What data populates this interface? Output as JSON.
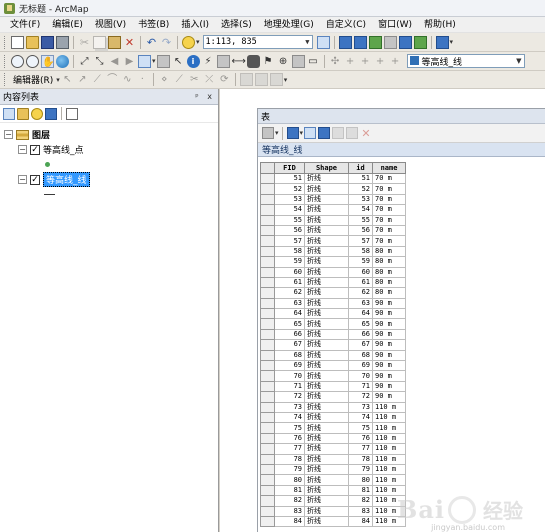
{
  "window": {
    "title": "无标题 - ArcMap"
  },
  "menu": [
    "文件(F)",
    "编辑(E)",
    "视图(V)",
    "书签(B)",
    "插入(I)",
    "选择(S)",
    "地理处理(G)",
    "自定义(C)",
    "窗口(W)",
    "帮助(H)"
  ],
  "toolbar": {
    "scale": "1:113, 835",
    "editor_label": "编辑器(R)",
    "target_layer": "等高线_线"
  },
  "toc": {
    "title": "内容列表",
    "pin": "ᵖ x",
    "root": "图层",
    "layers": [
      {
        "name": "等高线_点",
        "checked": true,
        "selected": false
      },
      {
        "name": "等高线_线",
        "checked": true,
        "selected": true
      }
    ]
  },
  "table_window": {
    "title": "表",
    "tab": "等高线_线",
    "columns": [
      "FID",
      "Shape",
      "id",
      "name"
    ],
    "rows": [
      [
        "51",
        "折线",
        "51",
        "70 m"
      ],
      [
        "52",
        "折线",
        "52",
        "70 m"
      ],
      [
        "53",
        "折线",
        "53",
        "70 m"
      ],
      [
        "54",
        "折线",
        "54",
        "70 m"
      ],
      [
        "55",
        "折线",
        "55",
        "70 m"
      ],
      [
        "56",
        "折线",
        "56",
        "70 m"
      ],
      [
        "57",
        "折线",
        "57",
        "70 m"
      ],
      [
        "58",
        "折线",
        "58",
        "80 m"
      ],
      [
        "59",
        "折线",
        "59",
        "80 m"
      ],
      [
        "60",
        "折线",
        "60",
        "80 m"
      ],
      [
        "61",
        "折线",
        "61",
        "80 m"
      ],
      [
        "62",
        "折线",
        "62",
        "80 m"
      ],
      [
        "63",
        "折线",
        "63",
        "90 m"
      ],
      [
        "64",
        "折线",
        "64",
        "90 m"
      ],
      [
        "65",
        "折线",
        "65",
        "90 m"
      ],
      [
        "66",
        "折线",
        "66",
        "90 m"
      ],
      [
        "67",
        "折线",
        "67",
        "90 m"
      ],
      [
        "68",
        "折线",
        "68",
        "90 m"
      ],
      [
        "69",
        "折线",
        "69",
        "90 m"
      ],
      [
        "70",
        "折线",
        "70",
        "90 m"
      ],
      [
        "71",
        "折线",
        "71",
        "90 m"
      ],
      [
        "72",
        "折线",
        "72",
        "90 m"
      ],
      [
        "73",
        "折线",
        "73",
        "110 m"
      ],
      [
        "74",
        "折线",
        "74",
        "110 m"
      ],
      [
        "75",
        "折线",
        "75",
        "110 m"
      ],
      [
        "76",
        "折线",
        "76",
        "110 m"
      ],
      [
        "77",
        "折线",
        "77",
        "110 m"
      ],
      [
        "78",
        "折线",
        "78",
        "110 m"
      ],
      [
        "79",
        "折线",
        "79",
        "110 m"
      ],
      [
        "80",
        "折线",
        "80",
        "110 m"
      ],
      [
        "81",
        "折线",
        "81",
        "110 m"
      ],
      [
        "82",
        "折线",
        "82",
        "110 m"
      ],
      [
        "83",
        "折线",
        "83",
        "110 m"
      ],
      [
        "84",
        "折线",
        "84",
        "110 m"
      ]
    ]
  },
  "watermark": {
    "brand": "Bai",
    "cn": "经验",
    "url": "jingyan.baidu.com"
  }
}
